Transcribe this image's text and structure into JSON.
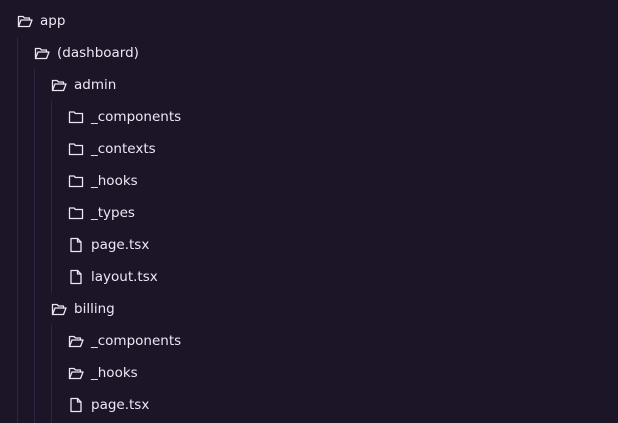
{
  "colors": {
    "background": "#1c1528",
    "text": "#ece8f3",
    "icon": "#ece8f3",
    "guide": "#2e2640"
  },
  "tree": [
    {
      "label": "app",
      "kind": "folder-open",
      "depth": 0
    },
    {
      "label": "(dashboard)",
      "kind": "folder-open",
      "depth": 1
    },
    {
      "label": "admin",
      "kind": "folder-open",
      "depth": 2
    },
    {
      "label": "_components",
      "kind": "folder",
      "depth": 3
    },
    {
      "label": "_contexts",
      "kind": "folder",
      "depth": 3
    },
    {
      "label": "_hooks",
      "kind": "folder",
      "depth": 3
    },
    {
      "label": "_types",
      "kind": "folder",
      "depth": 3
    },
    {
      "label": "page.tsx",
      "kind": "file",
      "depth": 3
    },
    {
      "label": "layout.tsx",
      "kind": "file",
      "depth": 3
    },
    {
      "label": "billing",
      "kind": "folder-open",
      "depth": 2
    },
    {
      "label": "_components",
      "kind": "folder-open",
      "depth": 3
    },
    {
      "label": "_hooks",
      "kind": "folder-open",
      "depth": 3
    },
    {
      "label": "page.tsx",
      "kind": "file",
      "depth": 3
    }
  ]
}
